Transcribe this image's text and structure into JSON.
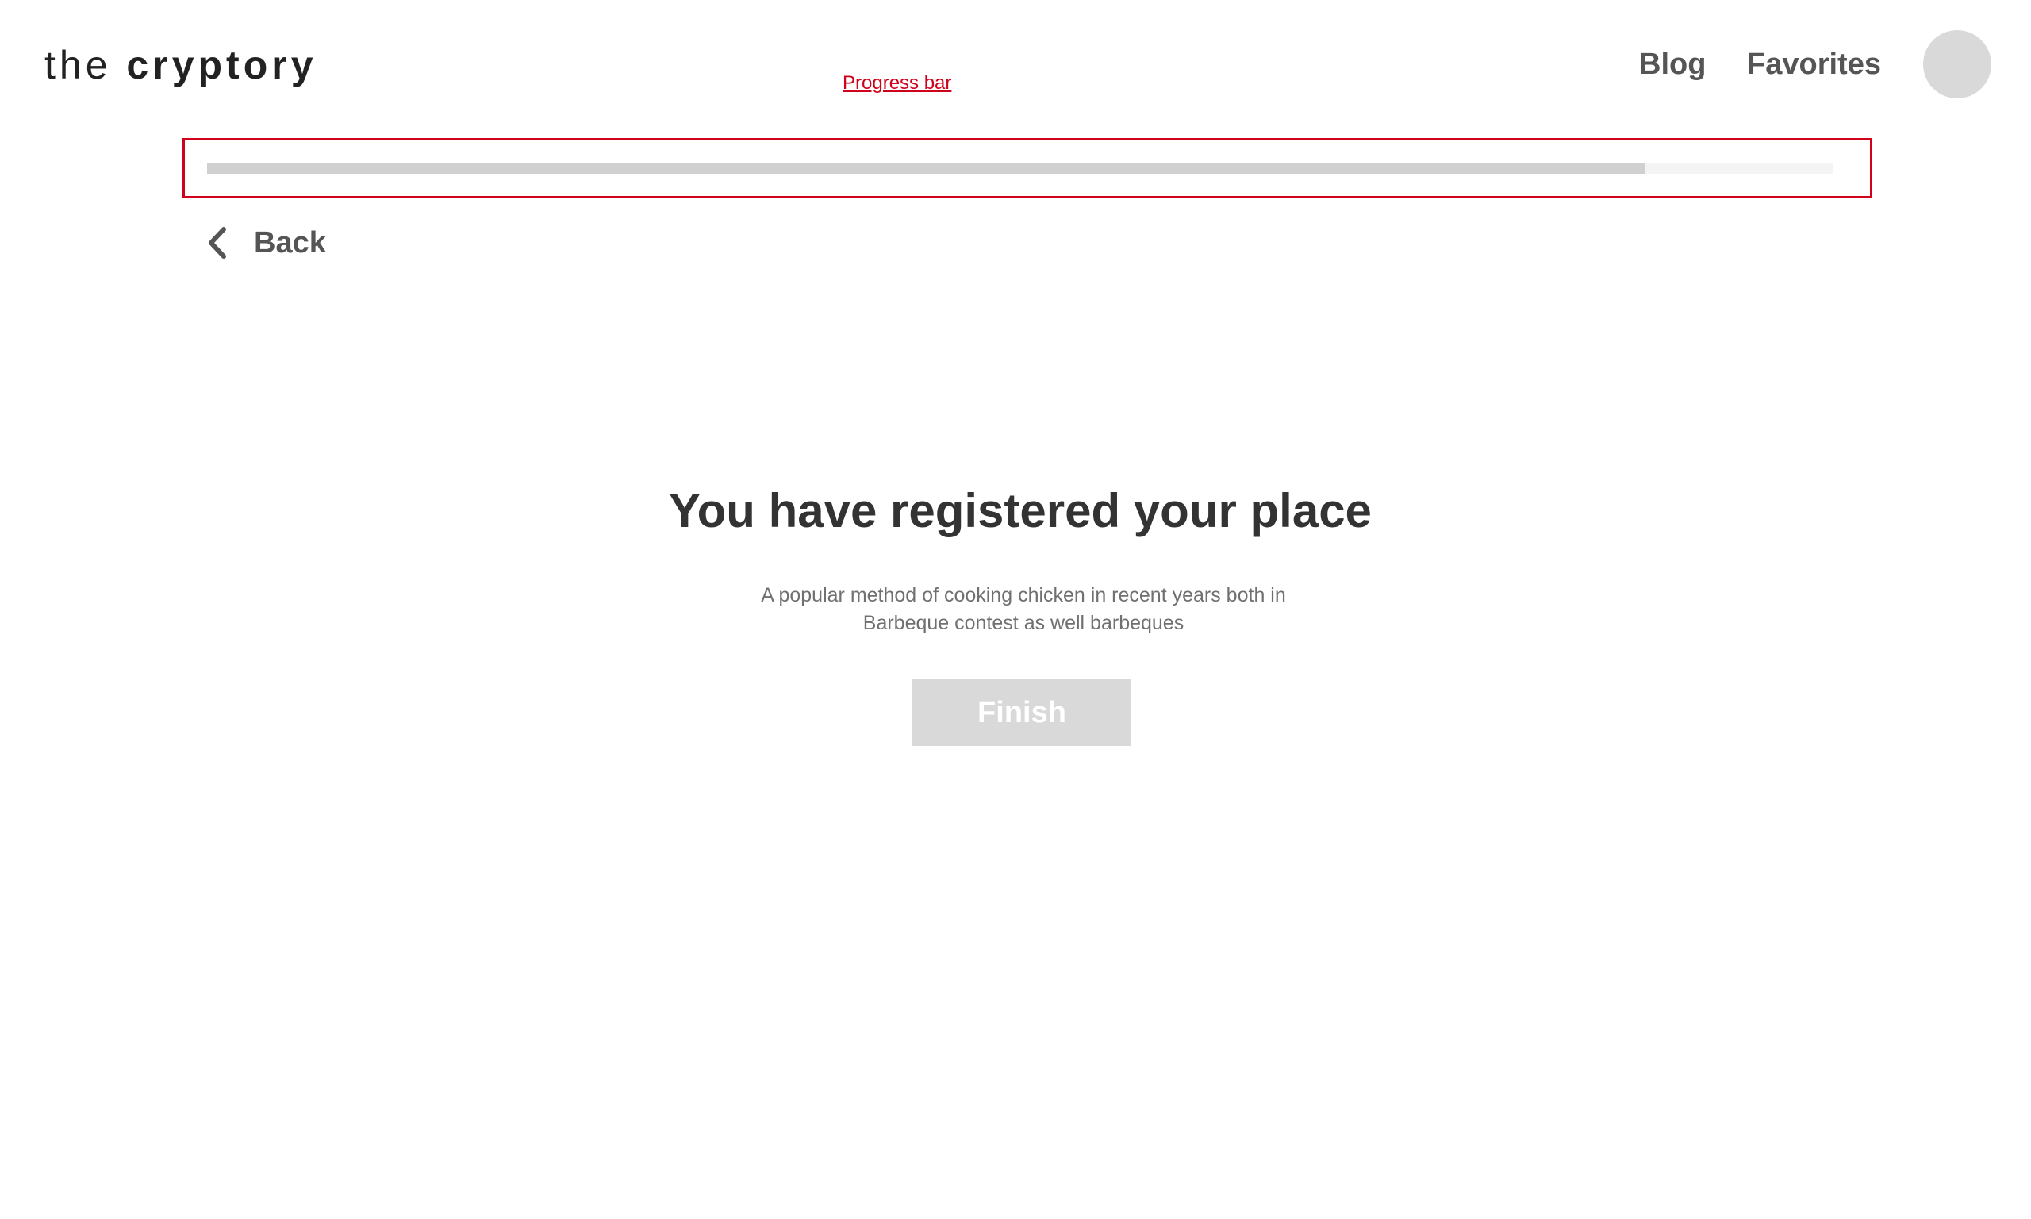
{
  "header": {
    "logo": {
      "light": "the",
      "bold": "cryptory"
    },
    "nav": {
      "blog": "Blog",
      "favorites": "Favorites"
    }
  },
  "annotation": {
    "label": "Progress bar",
    "color": "#d0021b"
  },
  "progress": {
    "fraction": 0.885
  },
  "back": {
    "label": "Back",
    "icon": "chevron-left-icon"
  },
  "main": {
    "title": "You have registered your place",
    "description_line1": "A popular method of cooking chicken in recent years both in",
    "description_line2": "Barbeque contest as well barbeques",
    "finish_label": "Finish"
  }
}
